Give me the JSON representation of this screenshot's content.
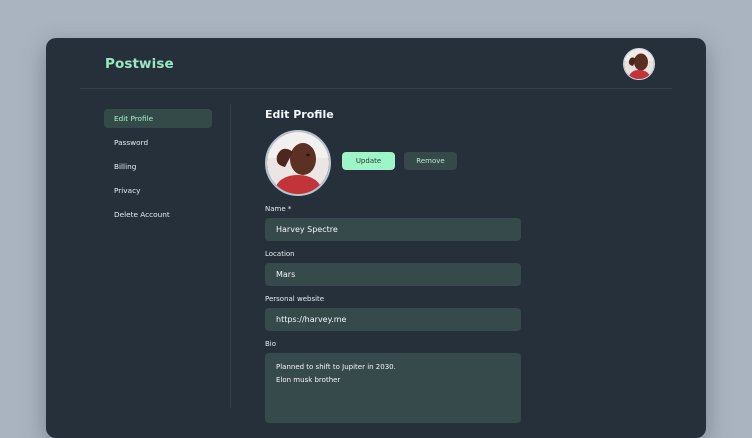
{
  "app": {
    "brand": "Postwise"
  },
  "sidebar": {
    "items": [
      {
        "label": "Edit Profile",
        "active": true
      },
      {
        "label": "Password"
      },
      {
        "label": "Billing"
      },
      {
        "label": "Privacy"
      },
      {
        "label": "Delete Account"
      }
    ]
  },
  "main": {
    "title": "Edit Profile",
    "update_label": "Update",
    "remove_label": "Remove",
    "fields": {
      "name": {
        "label": "Name *",
        "value": "Harvey Spectre"
      },
      "location": {
        "label": "Location",
        "value": "Mars"
      },
      "website": {
        "label": "Personal website",
        "value": "https://harvey.me"
      },
      "bio": {
        "label": "Bio",
        "lines": [
          "Planned to shift to Jupiter in 2030.",
          "Elon musk brother"
        ]
      }
    }
  },
  "colors": {
    "accent": "#9ef5c8",
    "background": "#26303b",
    "input": "#36494b"
  }
}
